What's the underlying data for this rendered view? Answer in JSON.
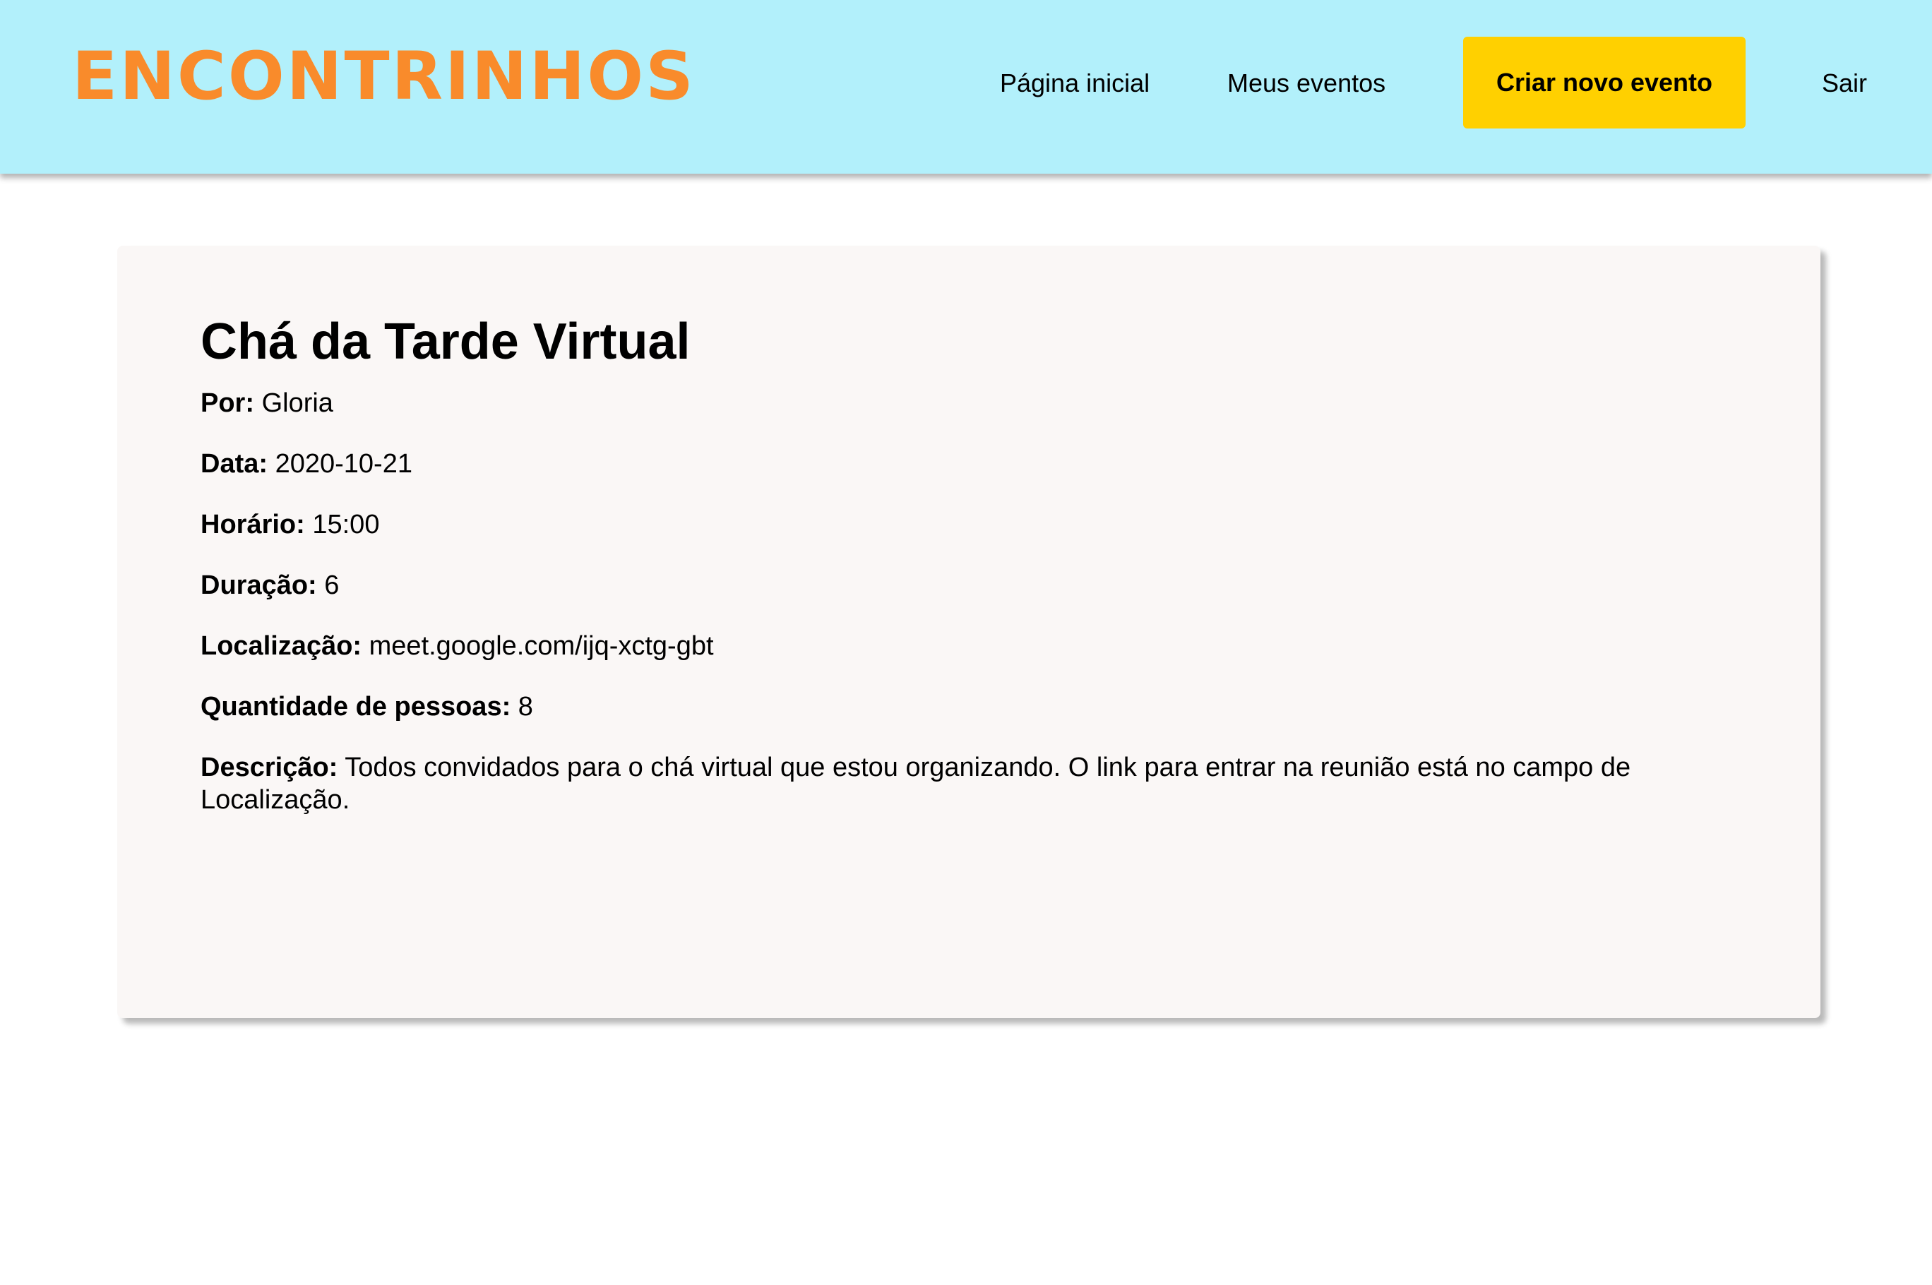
{
  "header": {
    "logo_text": "ENCONTRINHOS",
    "nav": {
      "home_label": "Página inicial",
      "my_events_label": "Meus eventos",
      "create_event_label": "Criar novo evento",
      "logout_label": "Sair"
    }
  },
  "event": {
    "title": "Chá da Tarde Virtual",
    "fields": [
      {
        "label": "Por:",
        "value": "Gloria"
      },
      {
        "label": "Data:",
        "value": "2020-10-21"
      },
      {
        "label": "Horário:",
        "value": "15:00"
      },
      {
        "label": "Duração:",
        "value": "6"
      },
      {
        "label": "Localização:",
        "value": "meet.google.com/ijq-xctg-gbt"
      },
      {
        "label": "Quantidade de pessoas:",
        "value": "8"
      },
      {
        "label": "Descrição:",
        "value": "Todos convidados para o chá virtual que estou organizando. O link para entrar na reunião está no campo de Localização."
      }
    ]
  },
  "colors": {
    "header_bg": "#b2f0fb",
    "logo": "#f98b2b",
    "cta_bg": "#ffd000",
    "card_bg": "#faf7f6"
  }
}
